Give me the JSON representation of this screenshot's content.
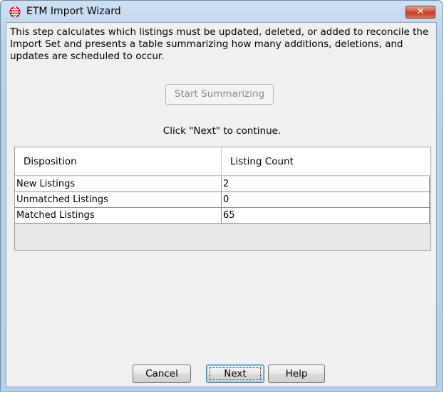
{
  "window": {
    "title": "ETM Import Wizard",
    "close_label": "✕"
  },
  "content": {
    "description": "This step calculates which listings must be updated, deleted, or added to reconcile the Import Set and presents a table summarizing how many additions, deletions, and updates are scheduled to occur.",
    "start_button": "Start Summarizing",
    "hint": "Click \"Next\" to continue."
  },
  "table": {
    "columns": [
      "Disposition",
      "Listing Count"
    ],
    "rows": [
      {
        "disposition": "New Listings",
        "count": "2"
      },
      {
        "disposition": "Unmatched Listings",
        "count": "0"
      },
      {
        "disposition": "Matched Listings",
        "count": "65"
      }
    ]
  },
  "buttons": {
    "cancel": "Cancel",
    "next": "Next",
    "help": "Help"
  },
  "colors": {
    "title_bar": "#b9d1ea",
    "close_button": "#c23b22",
    "app_icon": "#c8102e"
  },
  "icons": {
    "app": "globe-grid-icon",
    "close": "close-icon"
  }
}
